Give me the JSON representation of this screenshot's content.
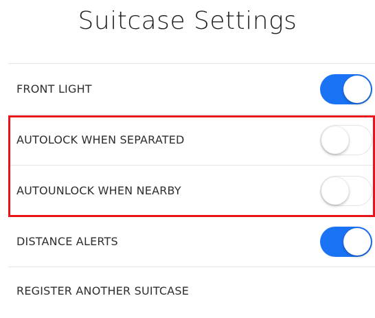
{
  "header": {
    "title": "Suitcase Settings"
  },
  "settings": [
    {
      "label": "FRONT LIGHT",
      "enabled": true
    },
    {
      "label": "AUTOLOCK WHEN SEPARATED",
      "enabled": false
    },
    {
      "label": "AUTOUNLOCK WHEN NEARBY",
      "enabled": false
    },
    {
      "label": "DISTANCE ALERTS",
      "enabled": true
    },
    {
      "label": "REGISTER ANOTHER SUITCASE"
    }
  ],
  "colors": {
    "toggle_on": "#1a73f4",
    "highlight": "#e8141c",
    "divider": "#e6e6e6"
  }
}
